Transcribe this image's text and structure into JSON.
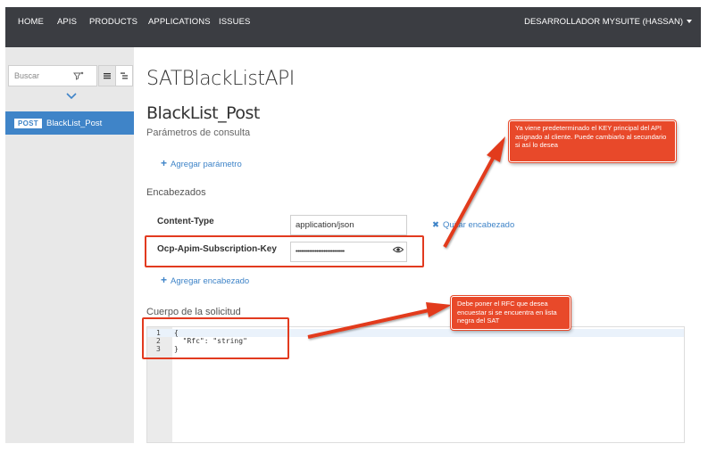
{
  "nav": {
    "items": [
      "HOME",
      "APIS",
      "PRODUCTS",
      "APPLICATIONS",
      "ISSUES"
    ],
    "user_menu": "DESARROLLADOR MYSUITE (HASSAN)"
  },
  "sidebar": {
    "search_placeholder": "Buscar",
    "endpoint": {
      "method": "POST",
      "name": "BlackList_Post"
    }
  },
  "main": {
    "api_title": "SATBlackListAPI",
    "operation_title": "BlackList_Post",
    "query_params_label": "Parámetros de consulta",
    "add_param": "Agregar parámetro",
    "headers_label": "Encabezados",
    "headers": [
      {
        "name": "Content-Type",
        "value": "application/json"
      },
      {
        "name": "Ocp-Apim-Subscription-Key",
        "value": "••••••••••••••••••••••••••••"
      }
    ],
    "remove_header": "Quitar encabezado",
    "add_header": "Agregar encabezado",
    "body_label": "Cuerpo de la solicitud",
    "code_lines": [
      {
        "num": "1",
        "text": "{"
      },
      {
        "num": "2",
        "text": "  \"Rfc\": \"string\""
      },
      {
        "num": "3",
        "text": "}"
      }
    ]
  },
  "annotations": {
    "callout_key": "Ya viene predeterminado el KEY principal del API asignado al cliente. Puede cambiarlo al secundario si así lo desea",
    "callout_rfc": "Debe poner el RFC que desea encuestar si se encuentra en lista negra del SAT",
    "color": "#e8492a"
  },
  "colors": {
    "nav_bg": "#3b3d42",
    "accent": "#3f84c8",
    "sidebar_bg": "#e8e8e8"
  }
}
